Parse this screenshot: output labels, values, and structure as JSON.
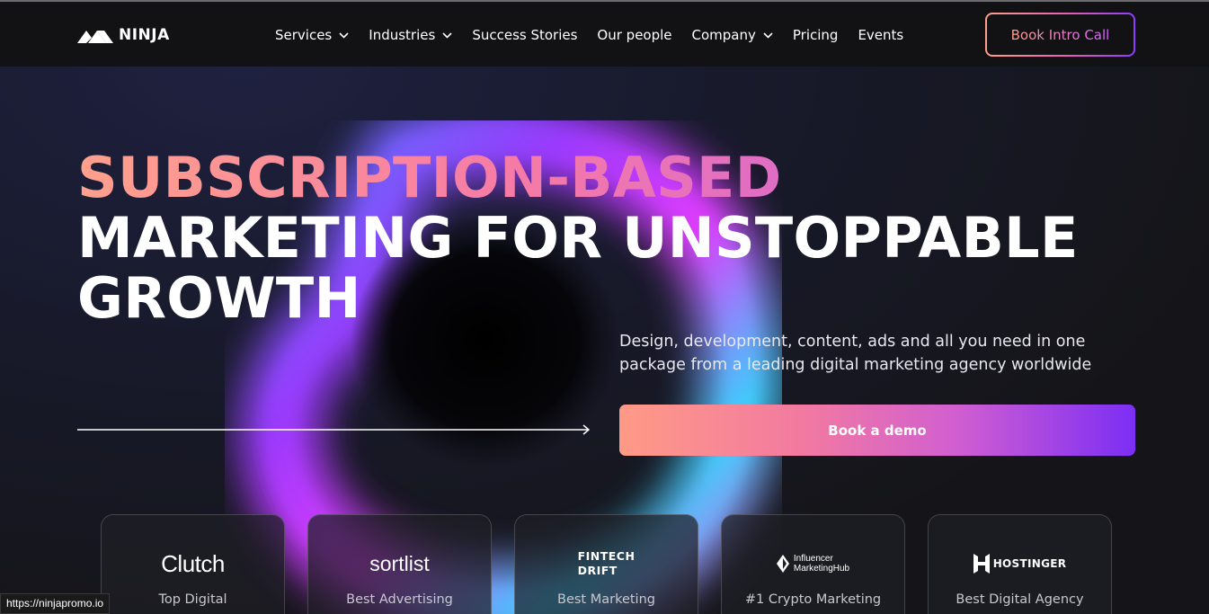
{
  "header": {
    "logo_text": "NINJA",
    "nav": [
      {
        "label": "Services",
        "dropdown": true
      },
      {
        "label": "Industries",
        "dropdown": true
      },
      {
        "label": "Success Stories",
        "dropdown": false
      },
      {
        "label": "Our people",
        "dropdown": false
      },
      {
        "label": "Company",
        "dropdown": true
      },
      {
        "label": "Pricing",
        "dropdown": false
      },
      {
        "label": "Events",
        "dropdown": false
      }
    ],
    "cta_label": "Book Intro Call"
  },
  "hero": {
    "title_line1": "SUBSCRIPTION-BASED",
    "title_line2": "MARKETING FOR UNSTOPPABLE",
    "title_line3": "GROWTH",
    "subtitle": "Design, development, content, ads and all you need in one package from a leading digital marketing agency worldwide",
    "demo_label": "Book a demo"
  },
  "awards": [
    {
      "logo": "Clutch",
      "text": "Top Digital"
    },
    {
      "logo": "sortlist",
      "text": "Best Advertising"
    },
    {
      "logo": "FINTECH DRIFT",
      "logo_line1": "FINTECH",
      "logo_line2": "DRIFT",
      "text": "Best Marketing"
    },
    {
      "logo": "Influencer MarketingHub",
      "logo_line1": "Influencer",
      "logo_line2": "MarketingHub",
      "text": "#1 Crypto Marketing"
    },
    {
      "logo": "HOSTINGER",
      "text": "Best Digital Agency"
    }
  ],
  "status_bar": {
    "url": "https://ninjapromo.io"
  },
  "colors": {
    "background": "#141418",
    "accent_start": "#ff9f8a",
    "accent_mid": "#e75fb5",
    "accent_end": "#7c2ef5"
  }
}
